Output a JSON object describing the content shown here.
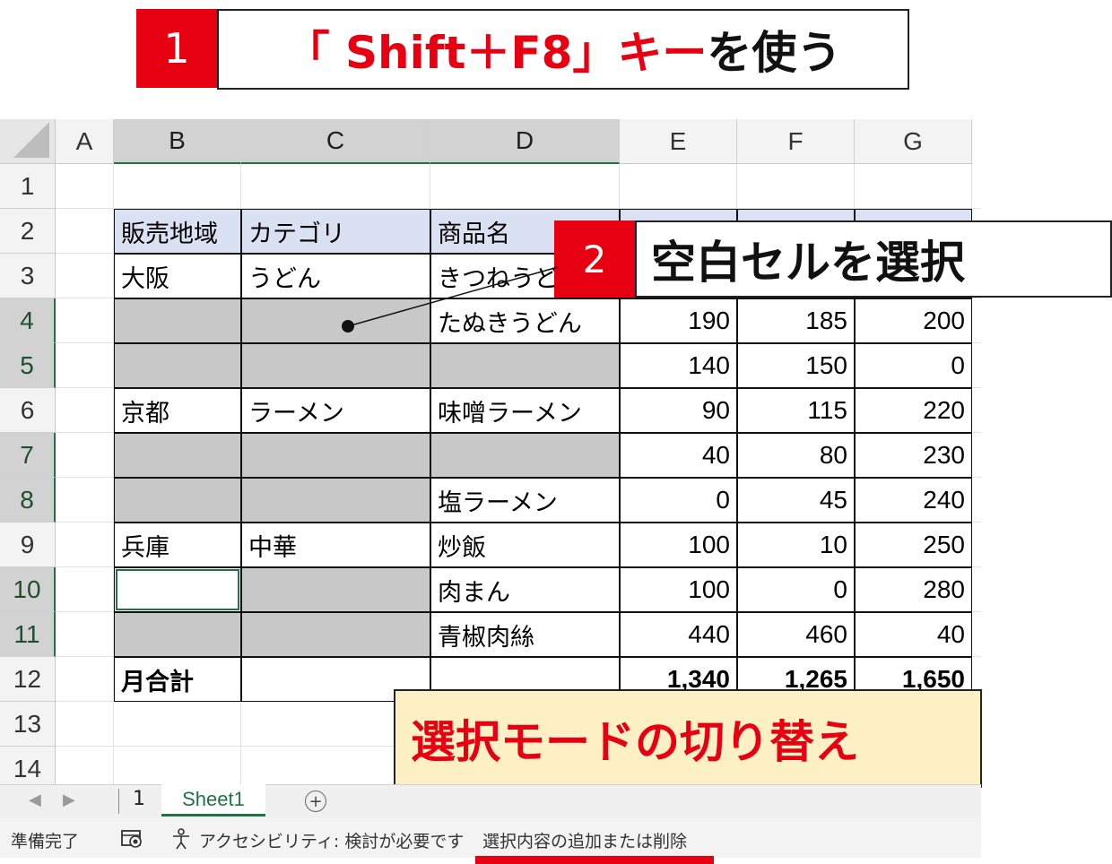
{
  "step1": {
    "number": "1",
    "key_label": "「 Shift＋F8」キー",
    "text": "を使う"
  },
  "step2": {
    "number": "2",
    "text": "空白セルを選択"
  },
  "bubble": {
    "text": "選択モードの切り替え"
  },
  "spreadsheet": {
    "columns": [
      "A",
      "B",
      "C",
      "D",
      "E",
      "F",
      "G"
    ],
    "rows": [
      "1",
      "2",
      "3",
      "4",
      "5",
      "6",
      "7",
      "8",
      "9",
      "10",
      "11",
      "12",
      "13",
      "14"
    ],
    "selected_columns": [
      "B",
      "C",
      "D"
    ],
    "selected_rows": [
      "4",
      "5",
      "7",
      "8",
      "10",
      "11"
    ],
    "header_row": [
      "販売地域",
      "カテゴリ",
      "商品名"
    ],
    "data_rows": [
      {
        "b": "大阪",
        "c": "うどん",
        "d": "きつねうど",
        "e": "",
        "f": "",
        "g": ""
      },
      {
        "b": "",
        "c": "",
        "d": "たぬきうどん",
        "e": "190",
        "f": "185",
        "g": "200"
      },
      {
        "b": "",
        "c": "",
        "d": "",
        "e": "140",
        "f": "150",
        "g": "0"
      },
      {
        "b": "京都",
        "c": "ラーメン",
        "d": "味噌ラーメン",
        "e": "90",
        "f": "115",
        "g": "220"
      },
      {
        "b": "",
        "c": "",
        "d": "",
        "e": "40",
        "f": "80",
        "g": "230"
      },
      {
        "b": "",
        "c": "",
        "d": "塩ラーメン",
        "e": "0",
        "f": "45",
        "g": "240"
      },
      {
        "b": "兵庫",
        "c": "中華",
        "d": "炒飯",
        "e": "100",
        "f": "10",
        "g": "250"
      },
      {
        "b": "",
        "c": "",
        "d": "肉まん",
        "e": "100",
        "f": "0",
        "g": "280"
      },
      {
        "b": "",
        "c": "",
        "d": "青椒肉絲",
        "e": "440",
        "f": "460",
        "g": "40"
      }
    ],
    "total_row": {
      "b": "月合計",
      "e": "1,340",
      "f": "1,265",
      "g": "1,650"
    }
  },
  "sheet_tabs": {
    "prev_arrow": "◀",
    "next_arrow": "▶",
    "tab_plain": "1",
    "tab_active": "Sheet1",
    "add_icon": "+"
  },
  "status_bar": {
    "ready": "準備完了",
    "accessibility": "アクセシビリティ: 検討が必要です",
    "mode": "選択内容の追加または削除"
  },
  "colors": {
    "accent_red": "#e60012",
    "excel_green": "#217346",
    "header_fill": "#d9e1f2",
    "blank_fill": "#c8c8c8",
    "bubble_fill": "#fdf0c4"
  }
}
